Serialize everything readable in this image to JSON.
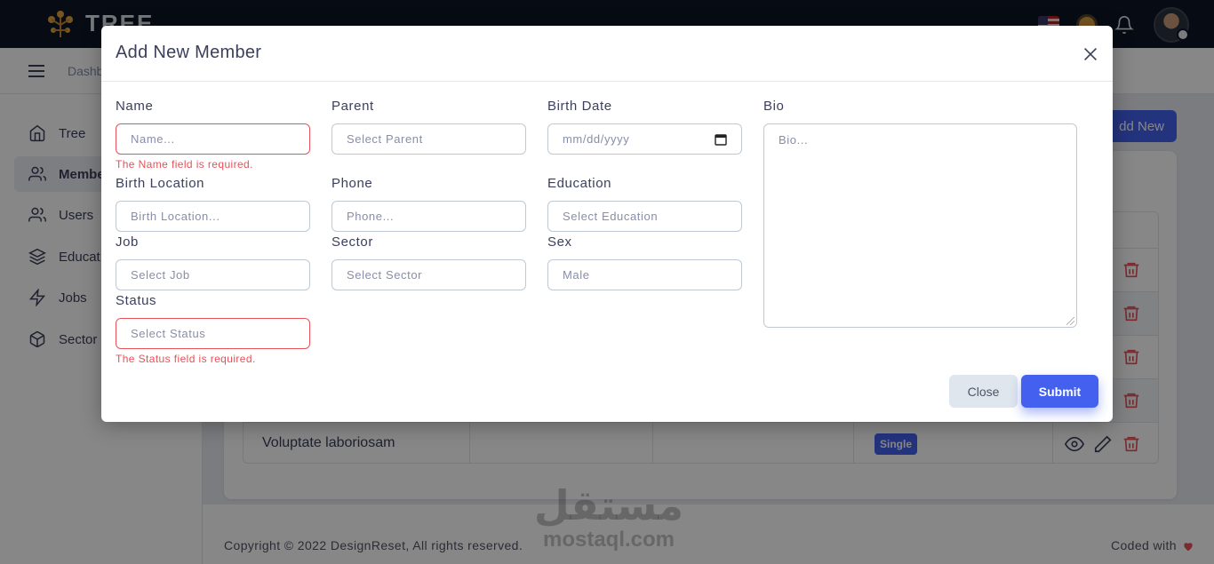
{
  "app": {
    "logo_text": "TREE"
  },
  "header": {
    "breadcrumb": "Dashb"
  },
  "sidebar": {
    "items": [
      {
        "label": "Tree",
        "icon": "home-icon"
      },
      {
        "label": "Membe",
        "icon": "users-icon"
      },
      {
        "label": "Users",
        "icon": "users-icon"
      },
      {
        "label": "Educat",
        "icon": "layers-icon"
      },
      {
        "label": "Jobs",
        "icon": "zap-icon"
      },
      {
        "label": "Sector",
        "icon": "box-icon"
      }
    ]
  },
  "page": {
    "add_new_label": "dd New",
    "table": {
      "rows": [
        {
          "name": "",
          "badge": ""
        },
        {
          "name": "",
          "badge": ""
        },
        {
          "name": "",
          "badge": ""
        },
        {
          "name": "",
          "badge": ""
        },
        {
          "name": "Voluptate laboriosam",
          "badge": "Single"
        }
      ]
    }
  },
  "modal": {
    "title": "Add New Member",
    "fields": {
      "name": {
        "label": "Name",
        "placeholder": "Name...",
        "error": "The Name field is required."
      },
      "parent": {
        "label": "Parent",
        "placeholder": "Select Parent"
      },
      "birth_date": {
        "label": "Birth Date",
        "placeholder": "mm/dd/yyyy"
      },
      "bio": {
        "label": "Bio",
        "placeholder": "Bio..."
      },
      "birth_location": {
        "label": "Birth Location",
        "placeholder": "Birth Location..."
      },
      "phone": {
        "label": "Phone",
        "placeholder": "Phone..."
      },
      "education": {
        "label": "Education",
        "placeholder": "Select Education"
      },
      "job": {
        "label": "Job",
        "placeholder": "Select Job"
      },
      "sector": {
        "label": "Sector",
        "placeholder": "Select Sector"
      },
      "sex": {
        "label": "Sex",
        "value": "Male"
      },
      "status": {
        "label": "Status",
        "placeholder": "Select Status",
        "error": "The Status field is required."
      }
    },
    "buttons": {
      "close": "Close",
      "submit": "Submit"
    }
  },
  "footer": {
    "copyright": "Copyright © 2022 DesignReset, All rights reserved.",
    "coded_with": "Coded with"
  },
  "watermark": {
    "arabic": "مستقل",
    "latin": "mostaql.com"
  },
  "colors": {
    "primary": "#4361ee",
    "danger": "#e7515a",
    "dark": "#0e1726"
  }
}
